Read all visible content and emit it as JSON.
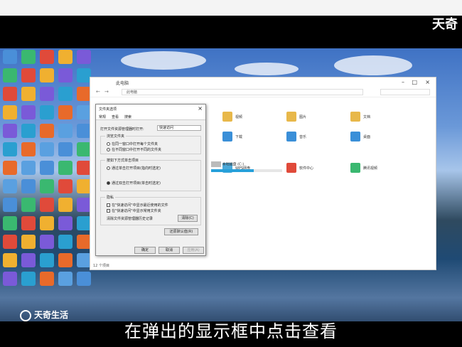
{
  "watermark_top": "天奇",
  "brand_bottom": "天奇生活",
  "subtitle": "在弹出的显示框中点击查看",
  "explorer": {
    "title": "此电脑",
    "address": "此电脑",
    "tiles": [
      {
        "label": "视频",
        "color": "#e8b84a"
      },
      {
        "label": "图片",
        "color": "#e8b84a"
      },
      {
        "label": "文档",
        "color": "#e8b84a"
      },
      {
        "label": "下载",
        "color": "#3a8fd8"
      },
      {
        "label": "音乐",
        "color": "#3a8fd8"
      },
      {
        "label": "桌面",
        "color": "#3a8fd8"
      },
      {
        "label": "WPS网盘",
        "color": "#4aa8d8"
      },
      {
        "label": "软件中心",
        "color": "#e04a3a"
      },
      {
        "label": "腾讯视频",
        "color": "#3ab870"
      }
    ],
    "drive_label": "本地磁盘 (C:)",
    "status": "12 个项目"
  },
  "dialog": {
    "title": "文件夹选项",
    "tabs": [
      "常规",
      "查看",
      "搜索"
    ],
    "open_label": "打开文件资源管理器时打开:",
    "open_value": "快速访问",
    "browse_group": "浏览文件夹",
    "browse_opt1": "在同一窗口中打开每个文件夹",
    "browse_opt2": "在不同窗口中打开不同的文件夹",
    "click_group": "按如下方式单击项目",
    "click_opt1": "通过单击打开项目(指向时选定)",
    "click_opt2": "通过双击打开项目(单击时选定)",
    "privacy_group": "隐私",
    "privacy_opt1": "在\"快速访问\"中显示最近使用的文件",
    "privacy_opt2": "在\"快速访问\"中显示常用文件夹",
    "clear_label": "清除文件资源管理器历史记录",
    "clear_button": "清除(C)",
    "restore_button": "还原默认值(R)",
    "ok": "确定",
    "cancel": "取消",
    "apply": "应用(A)"
  }
}
